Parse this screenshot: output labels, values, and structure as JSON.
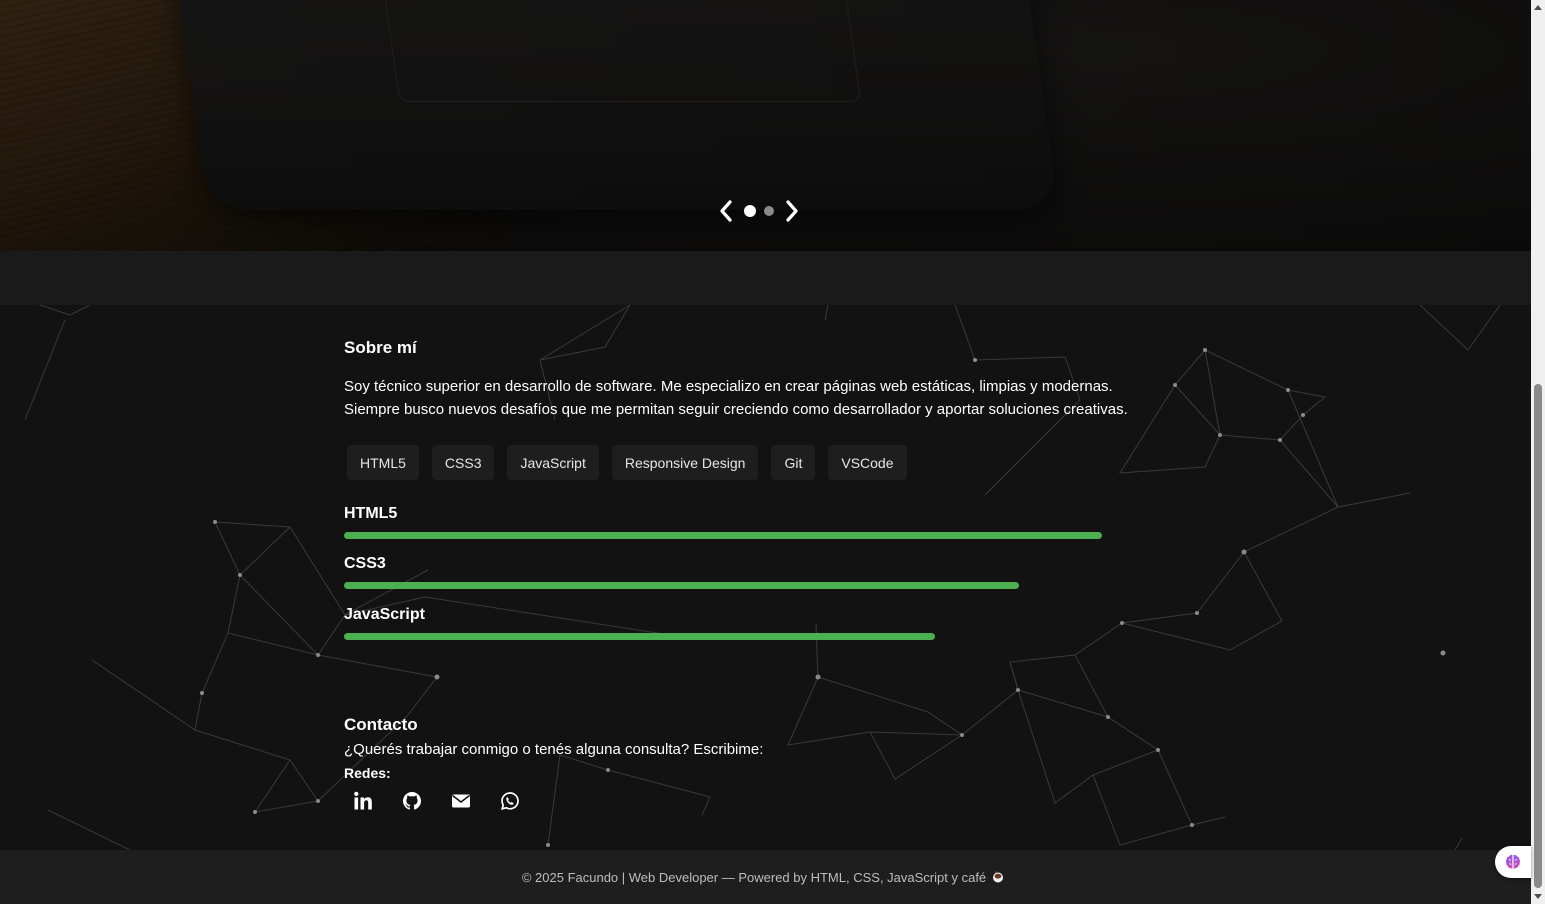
{
  "hero": {
    "prev_label": "❮",
    "next_label": "❯",
    "active_slide": 1,
    "slide_count": 2
  },
  "about": {
    "title": "Sobre mí",
    "text_line1": "Soy técnico superior en desarrollo de software. Me especializo en crear páginas web estáticas, limpias y modernas.",
    "text_line2": "Siempre busco nuevos desafíos que me permitan seguir creciendo como desarrollador y aportar soluciones creativas.",
    "chips": [
      "HTML5",
      "CSS3",
      "JavaScript",
      "Responsive Design",
      "Git",
      "VSCode"
    ]
  },
  "skills": [
    {
      "name": "HTML5",
      "percent": 100
    },
    {
      "name": "CSS3",
      "percent": 89
    },
    {
      "name": "JavaScript",
      "percent": 78
    }
  ],
  "contact": {
    "title": "Contacto",
    "text": "¿Querés trabajar conmigo o tenés alguna consulta? Escribime:",
    "redes_label": "Redes:",
    "socials": [
      "linkedin-icon",
      "github-icon",
      "envelope-icon",
      "whatsapp-icon"
    ]
  },
  "footer": {
    "text": "© 2025 Facundo | Web Developer — Powered by HTML, CSS, JavaScript y café"
  },
  "colors": {
    "accent": "#4caf50",
    "background": "#121212",
    "footer_bg": "#1e1e1e"
  }
}
